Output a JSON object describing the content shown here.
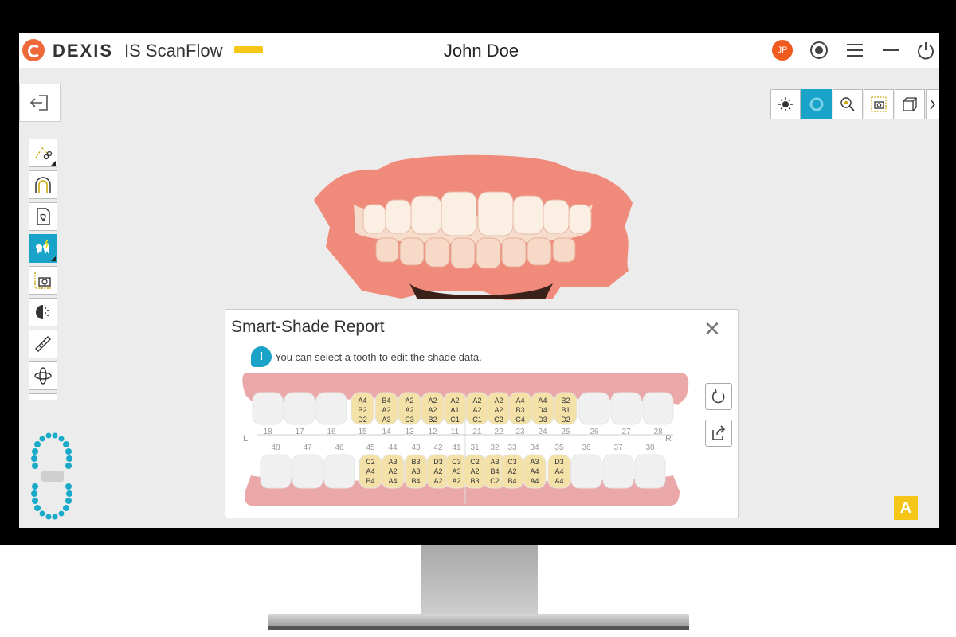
{
  "app": {
    "brand": "DEXIS",
    "product": "IS ScanFlow",
    "patient_name": "John Doe",
    "user_initials": "JP"
  },
  "icons": {
    "exit": "exit-icon",
    "record": "record-icon",
    "menu": "menu-icon",
    "minimize": "minimize-icon",
    "power": "power-icon"
  },
  "colors": {
    "accent": "#1aa3c8",
    "brand": "#ef6a3a",
    "tooth_shade": "#f3e1a8",
    "gum": "#eba8a8"
  },
  "report": {
    "title": "Smart-Shade Report",
    "info": "You can select a tooth to edit the shade data.",
    "left_label": "L",
    "right_label": "R",
    "upper": [
      {
        "num": "18",
        "shades": []
      },
      {
        "num": "17",
        "shades": []
      },
      {
        "num": "16",
        "shades": []
      },
      {
        "num": "15",
        "shades": [
          "A4",
          "B2",
          "D2"
        ]
      },
      {
        "num": "14",
        "shades": [
          "B4",
          "A2",
          "A3"
        ]
      },
      {
        "num": "13",
        "shades": [
          "A2",
          "A2",
          "C3"
        ]
      },
      {
        "num": "12",
        "shades": [
          "A2",
          "A2",
          "B2"
        ]
      },
      {
        "num": "11",
        "shades": [
          "A2",
          "A1",
          "C1"
        ]
      },
      {
        "num": "21",
        "shades": [
          "A2",
          "A2",
          "C1"
        ]
      },
      {
        "num": "22",
        "shades": [
          "A2",
          "A2",
          "C2"
        ]
      },
      {
        "num": "23",
        "shades": [
          "A4",
          "B3",
          "C4"
        ]
      },
      {
        "num": "24",
        "shades": [
          "A4",
          "D4",
          "D3"
        ]
      },
      {
        "num": "25",
        "shades": [
          "B2",
          "B1",
          "D2"
        ]
      },
      {
        "num": "26",
        "shades": []
      },
      {
        "num": "27",
        "shades": []
      },
      {
        "num": "28",
        "shades": []
      }
    ],
    "lower": [
      {
        "num": "48",
        "shades": []
      },
      {
        "num": "47",
        "shades": []
      },
      {
        "num": "46",
        "shades": []
      },
      {
        "num": "45",
        "shades": [
          "C2",
          "A4",
          "B4"
        ]
      },
      {
        "num": "44",
        "shades": [
          "A3",
          "A2",
          "A4"
        ]
      },
      {
        "num": "43",
        "shades": [
          "B3",
          "A3",
          "B4"
        ]
      },
      {
        "num": "42",
        "shades": [
          "D3",
          "A2",
          "A2"
        ]
      },
      {
        "num": "41",
        "shades": [
          "C3",
          "A3",
          "A2"
        ]
      },
      {
        "num": "31",
        "shades": [
          "C2",
          "A2",
          "B3"
        ]
      },
      {
        "num": "32",
        "shades": [
          "A3",
          "B4",
          "C2"
        ]
      },
      {
        "num": "33",
        "shades": [
          "C3",
          "A2",
          "B4"
        ]
      },
      {
        "num": "34",
        "shades": [
          "A3",
          "A4",
          "A4"
        ]
      },
      {
        "num": "35",
        "shades": [
          "D3",
          "A4",
          "A4"
        ]
      },
      {
        "num": "36",
        "shades": []
      },
      {
        "num": "37",
        "shades": []
      },
      {
        "num": "38",
        "shades": []
      }
    ]
  },
  "corner_badge": "A"
}
